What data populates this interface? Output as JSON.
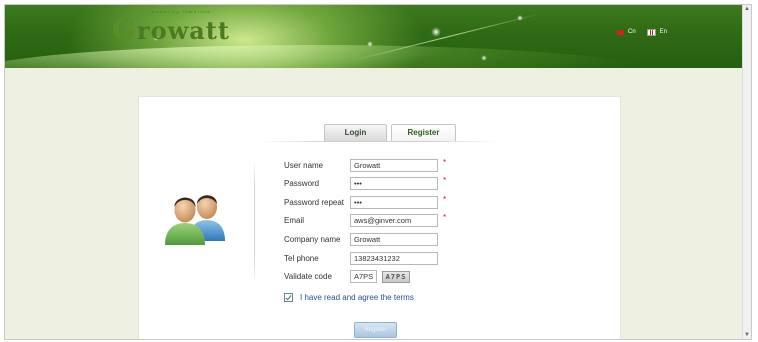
{
  "header": {
    "brand_tagline": "powering tomorrow",
    "brand_name_first": "G",
    "brand_name_rest": "rowatt",
    "lang_cn": "Cn",
    "lang_en": "En"
  },
  "tabs": {
    "login": "Login",
    "register": "Register",
    "active": "Register"
  },
  "form": {
    "username": {
      "label": "User name",
      "value": "Growatt",
      "required": "*"
    },
    "password": {
      "label": "Password",
      "value": "•••",
      "required": "*"
    },
    "password_repeat": {
      "label": "Password repeat",
      "value": "•••",
      "required": "*"
    },
    "email": {
      "label": "Email",
      "value": "aws@ginver.com",
      "required": "*"
    },
    "company": {
      "label": "Company name",
      "value": "Growatt"
    },
    "phone": {
      "label": "Tel phone",
      "value": "13823431232"
    },
    "validate": {
      "label": "Validate code",
      "value": "A7PS",
      "captcha_text": "A7PS"
    }
  },
  "terms": {
    "checked": true,
    "text": "I have read and agree the terms"
  },
  "register_button": "Register",
  "colors": {
    "header_green": "#2f6a14",
    "brand_green": "#4c7a22",
    "page_bg": "#eef0e2",
    "link_blue": "#2c4ea0",
    "required_red": "#dd1111"
  }
}
